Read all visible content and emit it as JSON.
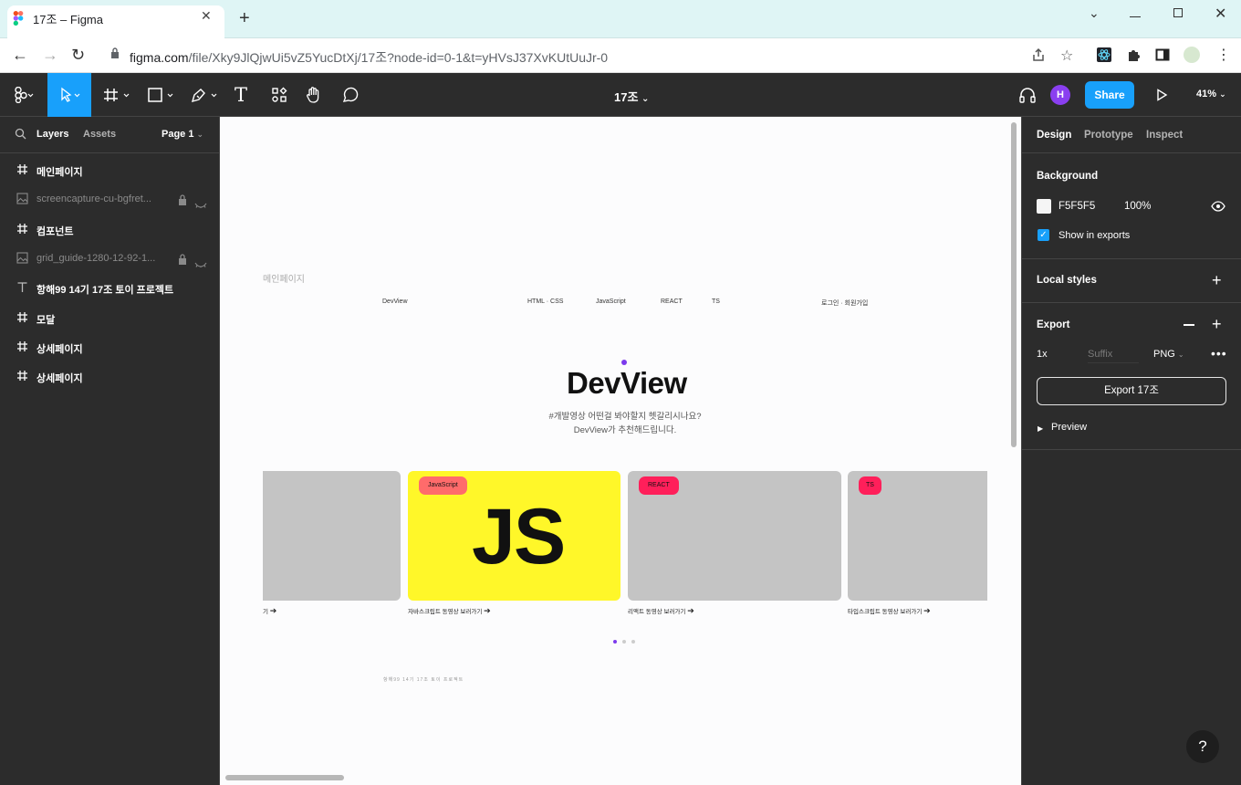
{
  "browser": {
    "tab_title": "17조 – Figma",
    "tab_close": "✕",
    "new_tab": "+",
    "url_host": "figma.com",
    "url_path": "/file/Xky9JlQjwUi5vZ5YucDtXj/17조?node-id=0-1&t=yHVsJ37XvKUtUuJr-0"
  },
  "toolbar": {
    "file_name": "17조",
    "avatar_initial": "H",
    "share_label": "Share",
    "zoom": "41%"
  },
  "left_panel": {
    "tab_layers": "Layers",
    "tab_assets": "Assets",
    "page_selector": "Page 1",
    "layers": [
      {
        "name": "메인페이지",
        "type": "frame",
        "dimmed": false
      },
      {
        "name": "screencapture-cu-bgfret...",
        "type": "image",
        "dimmed": true,
        "locked": true,
        "hidden": true
      },
      {
        "name": "컴포넌트",
        "type": "frame",
        "dimmed": false
      },
      {
        "name": "grid_guide-1280-12-92-1...",
        "type": "image",
        "dimmed": true,
        "locked": true,
        "hidden": true
      },
      {
        "name": "항해99 14기 17조 토이 프로젝트",
        "type": "text",
        "dimmed": false
      },
      {
        "name": "모달",
        "type": "frame",
        "dimmed": false
      },
      {
        "name": "상세페이지",
        "type": "frame",
        "dimmed": false
      },
      {
        "name": "상세페이지",
        "type": "frame",
        "dimmed": false
      }
    ]
  },
  "canvas": {
    "frame_label": "메인페이지",
    "nav": {
      "brand": "DevView",
      "item_html": "HTML · CSS",
      "item_js": "JavaScript",
      "item_react": "REACT",
      "item_ts": "TS",
      "auth": "로그인 · 회원가입"
    },
    "logo": "DevView",
    "tagline_line1": "#개발영상 어떤걸 봐야할지 헷갈리시나요?",
    "tagline_line2": "DevView가 추천해드립니다.",
    "cards": [
      {
        "caption": "기",
        "badge": ""
      },
      {
        "caption": "자바스크립트 동영상 보러가기",
        "badge": "JavaScript",
        "big_text": "JS"
      },
      {
        "caption": "리액트 동영상 보러가기",
        "badge": "REACT"
      },
      {
        "caption": "타입스크립트 동영상 보러가기",
        "badge": "TS"
      }
    ],
    "carousel_active_index": 0,
    "footer_text": "항해99 14기 17조 토이 프로젝트"
  },
  "right_panel": {
    "tab_design": "Design",
    "tab_prototype": "Prototype",
    "tab_inspect": "Inspect",
    "background_title": "Background",
    "bg_hex": "F5F5F5",
    "bg_opacity": "100%",
    "show_in_exports": "Show in exports",
    "local_styles": "Local styles",
    "export_title": "Export",
    "export_scale": "1x",
    "export_suffix_placeholder": "Suffix",
    "export_format": "PNG",
    "export_button": "Export 17조",
    "preview": "Preview"
  },
  "help_label": "?",
  "colors": {
    "figma_blue": "#18a0fb",
    "panel_bg": "#2c2c2c",
    "js_yellow": "#fff729",
    "badge_red": "#ff1f5a",
    "badge_coral": "#ff6b6b",
    "avatar_purple": "#8a3ff0",
    "logo_dot": "#7c3aed"
  }
}
